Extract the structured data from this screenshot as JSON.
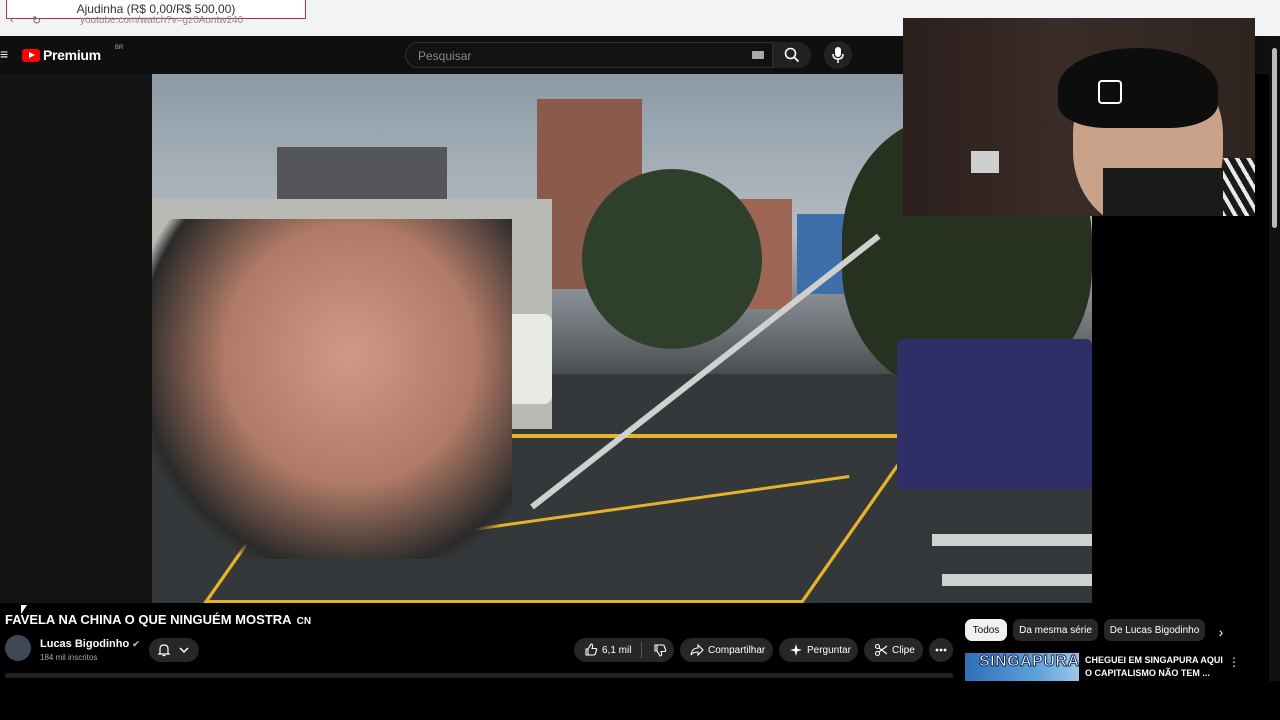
{
  "browser": {
    "donation_banner": "Ajudinha (R$ 0,00/R$ 500,00)",
    "url": "youtube.com/watch?v=gz0Auntw240"
  },
  "header": {
    "logo_text": "Premium",
    "logo_region": "BR",
    "search_placeholder": "Pesquisar"
  },
  "video": {
    "title": "FAVELA NA CHINA O QUE NINGUÉM MOSTRA",
    "title_suffix": "CN"
  },
  "channel": {
    "name": "Lucas Bigodinho",
    "subscribers": "184 mil inscritos"
  },
  "actions": {
    "likes": "6,1 mil",
    "share": "Compartilhar",
    "ask": "Perguntar",
    "clip": "Clipe"
  },
  "chips": [
    "Todos",
    "Da mesma série",
    "De Lucas Bigodinho"
  ],
  "recommendation": {
    "thumb_text": "SINGAPURA",
    "title": "CHEGUEI EM SINGAPURA AQUI O CAPITALISMO NÃO TEM ..."
  },
  "colors": {
    "accent": "#ff0000",
    "background": "#0f0f0f",
    "pill": "#272727"
  }
}
